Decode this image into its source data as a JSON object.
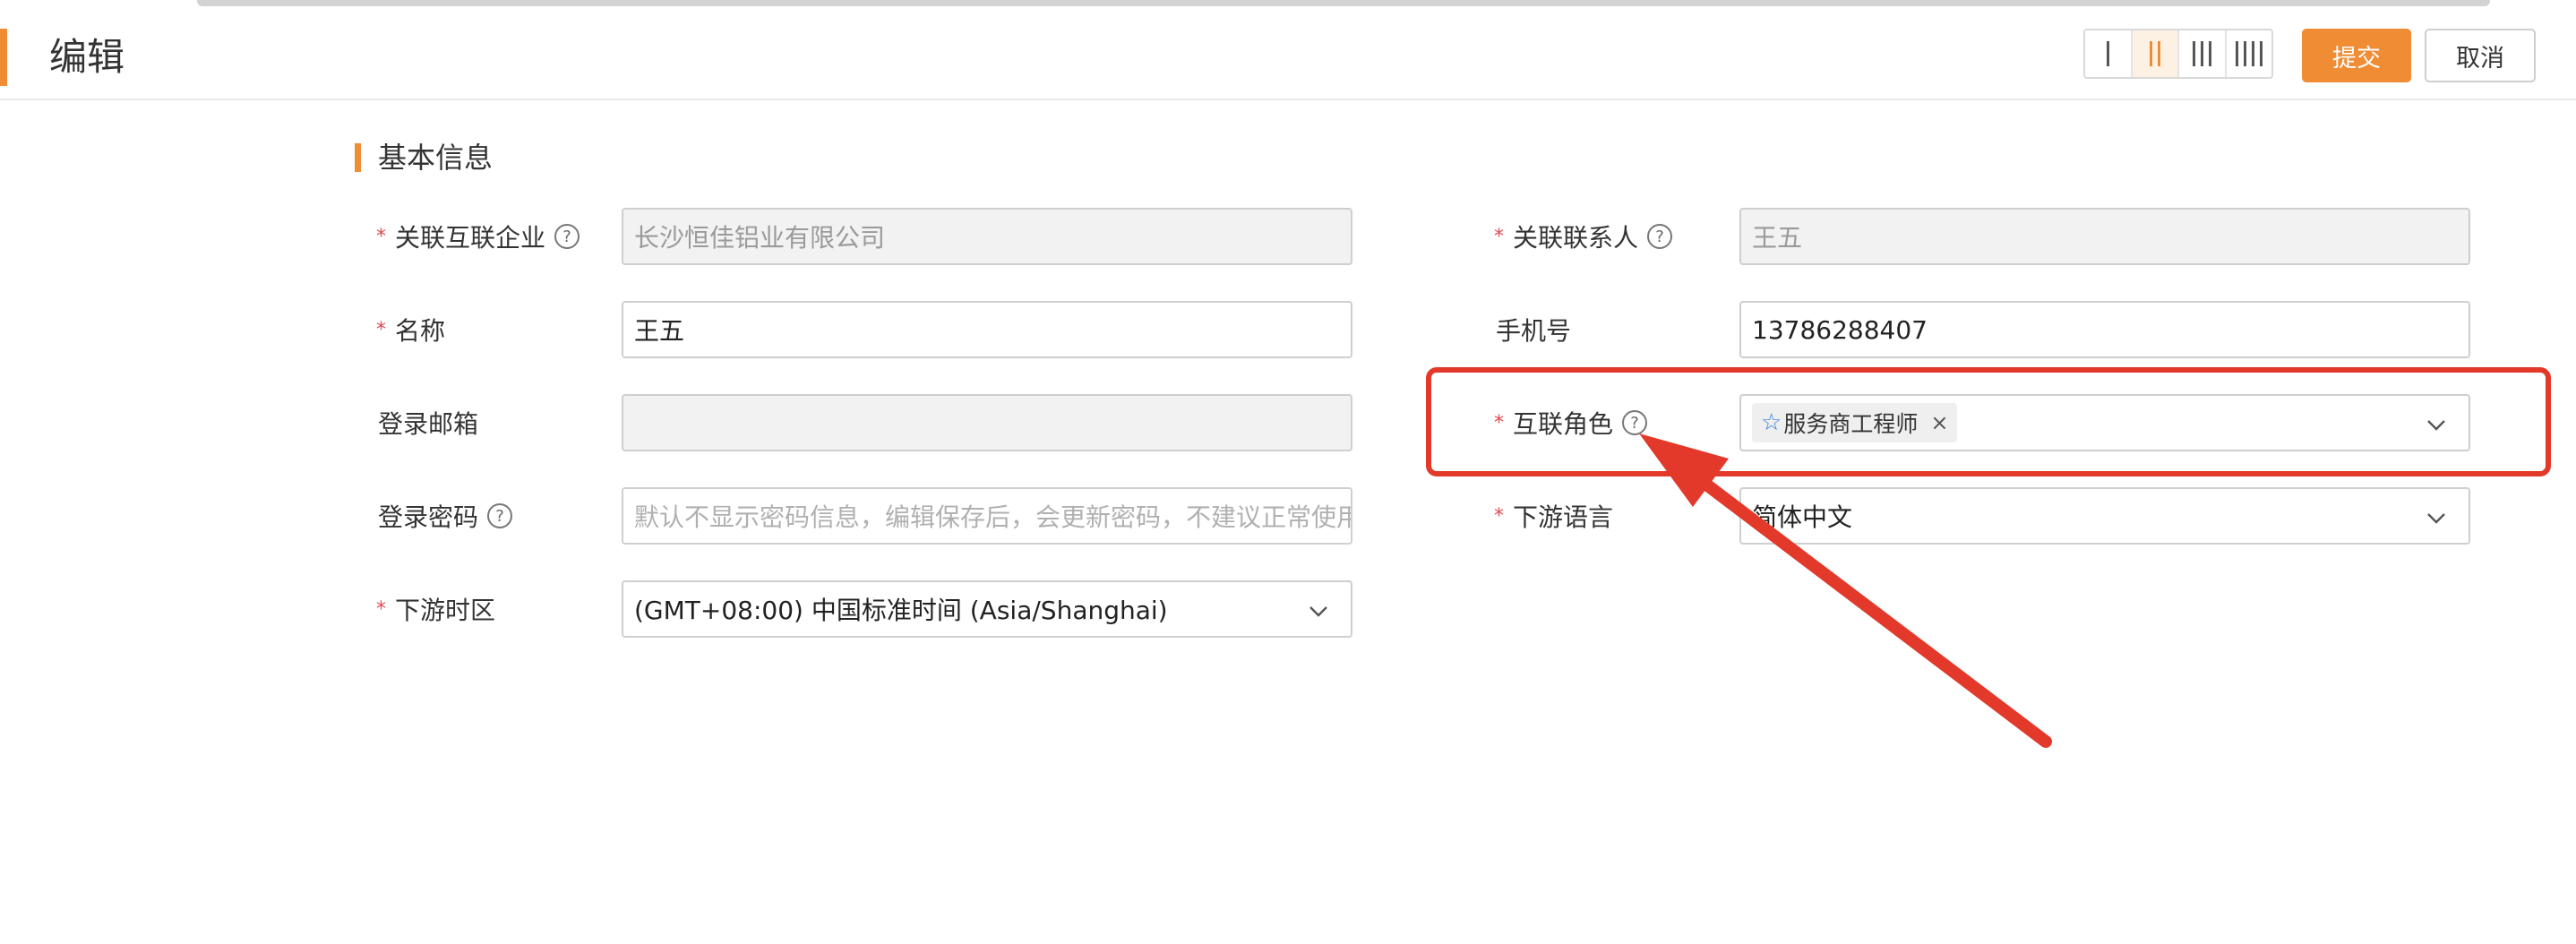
{
  "header": {
    "title": "编辑",
    "submit_label": "提交",
    "cancel_label": "取消",
    "column_options": [
      {
        "name": "one-column",
        "bars": 1,
        "active": false
      },
      {
        "name": "two-column",
        "bars": 2,
        "active": true
      },
      {
        "name": "three-column",
        "bars": 3,
        "active": false
      },
      {
        "name": "four-column",
        "bars": 4,
        "active": false
      }
    ]
  },
  "section": {
    "title": "基本信息"
  },
  "form": {
    "enterprise": {
      "label": "关联互联企业",
      "required": true,
      "help": true,
      "value": "长沙恒佳铝业有限公司",
      "disabled": true
    },
    "contact": {
      "label": "关联联系人",
      "required": true,
      "help": true,
      "value": "王五",
      "disabled": true
    },
    "name": {
      "label": "名称",
      "required": true,
      "value": "王五"
    },
    "phone": {
      "label": "手机号",
      "required": false,
      "value": "13786288407"
    },
    "email": {
      "label": "登录邮箱",
      "required": false,
      "value": "",
      "disabled": true
    },
    "role": {
      "label": "互联角色",
      "required": true,
      "help": true,
      "tags": [
        "服务商工程师"
      ],
      "tag_icon": "star-icon"
    },
    "password": {
      "label": "登录密码",
      "required": false,
      "help": true,
      "placeholder": "默认不显示密码信息，编辑保存后，会更新密码，不建议正常使用"
    },
    "language": {
      "label": "下游语言",
      "required": true,
      "value": "简体中文"
    },
    "timezone": {
      "label": "下游时区",
      "required": true,
      "value": "(GMT+08:00) 中国标准时间 (Asia/Shanghai)"
    }
  },
  "annotation": {
    "color": "#e3392b"
  }
}
